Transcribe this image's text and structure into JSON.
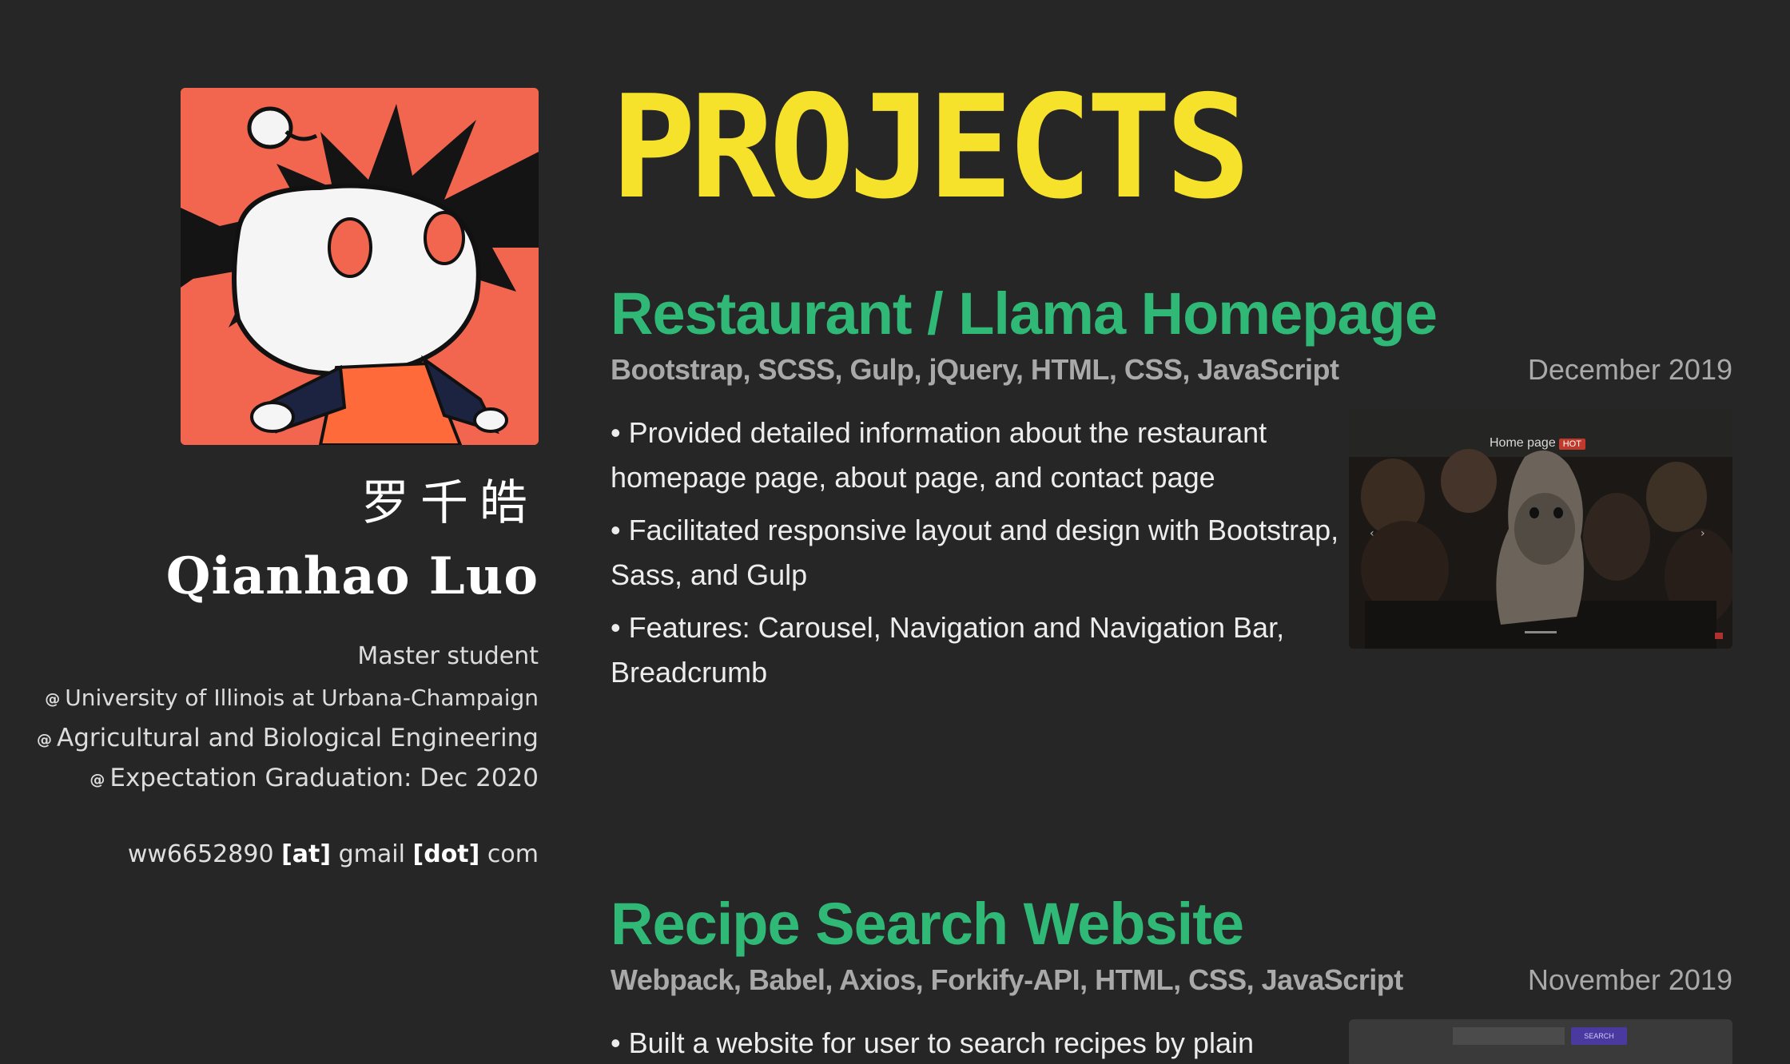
{
  "profile": {
    "name_cn": "罗千皓",
    "name_en": "Qianhao Luo",
    "role": "Master student",
    "affiliations": [
      "University of Illinois at Urbana-Champaign",
      "Agricultural and Biological Engineering",
      "Expectation Graduation: Dec 2020"
    ],
    "at_symbol": "@",
    "email": {
      "user": "ww6652890",
      "at": "[at]",
      "domain": "gmail",
      "dot": "[dot]",
      "tld": "com"
    }
  },
  "section_title": "PROJECTS",
  "projects": [
    {
      "title": "Restaurant / Llama Homepage",
      "tech": "Bootstrap, SCSS, Gulp, jQuery, HTML, CSS, JavaScript",
      "date": "December 2019",
      "bullets": [
        "Provided detailed information about the restaurant homepage page, about page, and contact page",
        "Facilitated responsive layout and design with Bootstrap, Sass, and Gulp",
        "Features: Carousel, Navigation and Navigation Bar, Breadcrumb"
      ],
      "thumbnail": {
        "label": "Home page",
        "badge": "HOT"
      }
    },
    {
      "title": "Recipe Search Website",
      "tech": "Webpack, Babel, Axios, Forkify-API, HTML, CSS, JavaScript",
      "date": "November 2019",
      "bullets": [
        "Built a website for user to search recipes by plain"
      ],
      "thumbnail": {
        "button": "SEARCH"
      }
    }
  ],
  "colors": {
    "background": "#262626",
    "section_title": "#f6e12b",
    "project_title": "#2fb876",
    "meta_text": "#a9a9a9",
    "avatar_bg": "#f2664f"
  },
  "icons": {
    "avatar": "cartoon-alien-avatar",
    "affiliation_marker": "at-sign-icon"
  }
}
